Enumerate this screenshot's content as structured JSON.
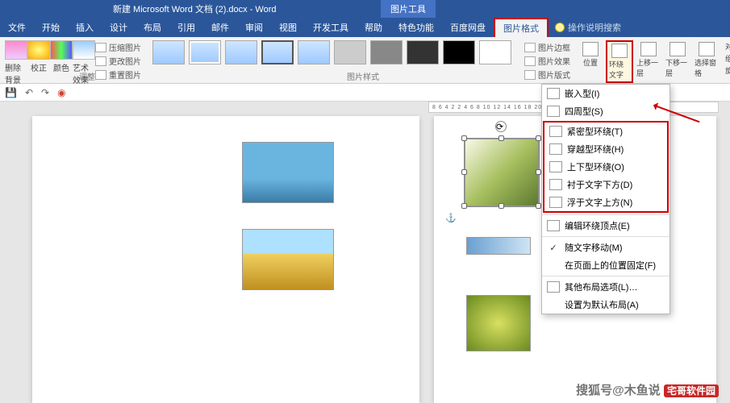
{
  "title": "新建 Microsoft Word 文档 (2).docx - Word",
  "tool_context": "图片工具",
  "tabs": [
    "文件",
    "开始",
    "插入",
    "设计",
    "布局",
    "引用",
    "邮件",
    "审阅",
    "视图",
    "开发工具",
    "帮助",
    "特色功能",
    "百度网盘",
    "图片格式"
  ],
  "tell_me": "操作说明搜索",
  "ribbon": {
    "remove_bg": "删除背景",
    "correct": "校正",
    "color": "颜色",
    "artistic": "艺术效果",
    "compress": "压缩图片",
    "change": "更改图片",
    "reset": "重置图片",
    "group_adjust": "调整",
    "group_style": "图片样式",
    "border": "图片边框",
    "effects": "图片效果",
    "layout": "图片版式",
    "position": "位置",
    "wrap": "环绕文字",
    "forward": "上移一层",
    "backward": "下移一层",
    "selection": "选择窗格",
    "align": "对齐",
    "group": "组合",
    "rotate": "旋转"
  },
  "ruler_text": "8 6 4 2   2 4 6 8 10 12 14 16 18 20 22 24 26 28 30",
  "dropdown": {
    "inline": "嵌入型(I)",
    "square": "四周型(S)",
    "tight": "紧密型环绕(T)",
    "through": "穿越型环绕(H)",
    "topbottom": "上下型环绕(O)",
    "behind": "衬于文字下方(D)",
    "front": "浮于文字上方(N)",
    "edit_points": "编辑环绕顶点(E)",
    "move_with": "随文字移动(M)",
    "fix_pos": "在页面上的位置固定(F)",
    "more": "其他布局选项(L)…",
    "default": "设置为默认布局(A)"
  },
  "watermark": {
    "badge": "宅哥软件园",
    "tail": "搜狐号@木鱼说"
  }
}
